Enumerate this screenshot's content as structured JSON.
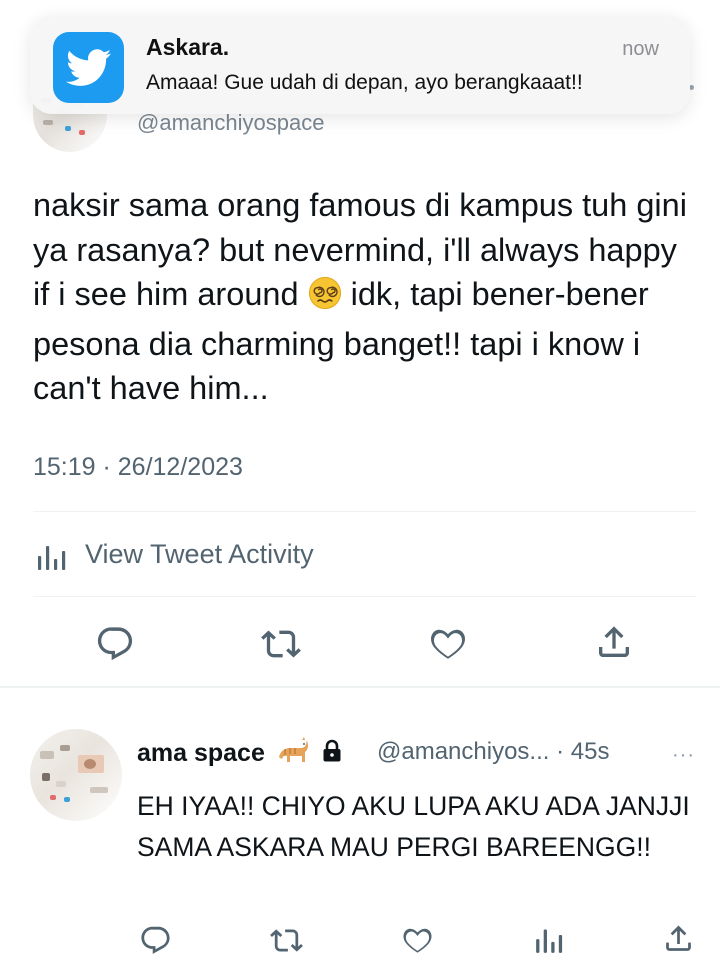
{
  "notification": {
    "app_icon": "twitter-bird-icon",
    "title": "Askara.",
    "time": "now",
    "message": "Amaaa! Gue udah di depan, ayo berangkaaat!!"
  },
  "tweet": {
    "handle": "@amanchiyospace",
    "text_before_emoji": "naksir sama orang famous di kampus tuh gini ya rasanya? but nevermind, i'll always happy if i see him around ",
    "emoji": "dizzy-face-emoji",
    "text_after_emoji": " idk, tapi bener-bener pesona dia charming banget!! tapi i know i can't have him...",
    "timestamp": "15:19 · 26/12/2023",
    "activity_label": "View Tweet Activity",
    "actions": [
      "reply-icon",
      "retweet-icon",
      "like-icon",
      "share-icon"
    ]
  },
  "reply": {
    "name": "ama space",
    "name_emoji": "cat-emoji",
    "lock_icon": "lock-icon",
    "handle_time": "@amanchiyos... · 45s",
    "more": "···",
    "text": "EH IYAA!! CHIYO AKU LUPA AKU ADA JANJJI SAMA ASKARA MAU PERGI BAREENGG!!",
    "actions": [
      "reply-icon",
      "retweet-icon",
      "like-icon",
      "views-icon",
      "share-icon"
    ]
  },
  "colors": {
    "twitter_blue": "#1d9bf0",
    "text_primary": "#0f1419",
    "text_secondary": "#536471",
    "divider": "#eff3f4"
  }
}
